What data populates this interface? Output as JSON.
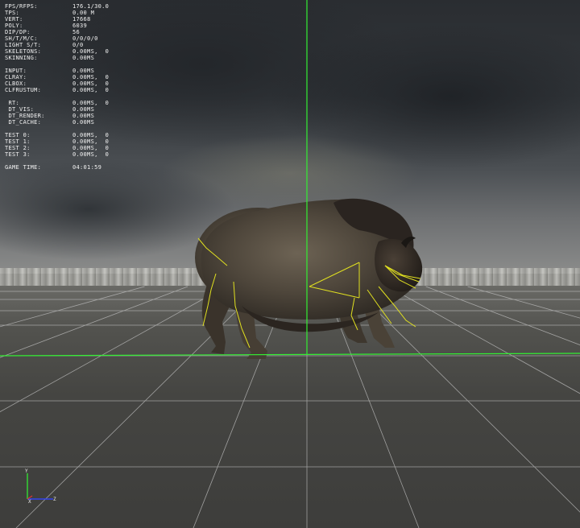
{
  "hud": {
    "stats": [
      {
        "label": "FPS/RFPS:",
        "value": "176.1/30.0"
      },
      {
        "label": "TPS:",
        "value": "0.00 M"
      },
      {
        "label": "VERT:",
        "value": "17668"
      },
      {
        "label": "POLY:",
        "value": "6039"
      },
      {
        "label": "DIP/DP:",
        "value": "56"
      },
      {
        "label": "SH/T/M/C:",
        "value": "0/0/0/0"
      },
      {
        "label": "LIGHT S/T:",
        "value": "0/0"
      },
      {
        "label": "SKELETONS:",
        "value": "0.00MS,  0"
      },
      {
        "label": "SKINNING:",
        "value": "0.00MS"
      }
    ],
    "cl": [
      {
        "label": "INPUT:",
        "value": "0.00MS"
      },
      {
        "label": "CLRAY:",
        "value": "0.00MS,  0"
      },
      {
        "label": "CLBOX:",
        "value": "0.00MS,  0"
      },
      {
        "label": "CLFRUSTUM:",
        "value": "0.00MS,  0"
      }
    ],
    "rt": [
      {
        "label": " RT:",
        "value": "0.00MS,  0"
      },
      {
        "label": " DT_VIS:",
        "value": "0.00MS"
      },
      {
        "label": " DT_RENDER:",
        "value": "0.00MS"
      },
      {
        "label": " DT_CACHE:",
        "value": "0.00MS"
      }
    ],
    "tests": [
      {
        "label": "TEST 0:",
        "value": "0.00MS,  0"
      },
      {
        "label": "TEST 1:",
        "value": "0.00MS,  0"
      },
      {
        "label": "TEST 2:",
        "value": "0.00MS,  0"
      },
      {
        "label": "TEST 3:",
        "value": "0.00MS,  0"
      }
    ],
    "game_time": {
      "label": "GAME TIME:",
      "value": "04:01:59"
    }
  },
  "axes": {
    "y": "Y",
    "x": "X",
    "z": "Z"
  },
  "colors": {
    "guide_line": "#33ee33",
    "bone_line": "#e0e020",
    "grid_line": "#bfbfbf",
    "axis_y": "#33dd33",
    "axis_z": "#3344ee"
  },
  "icons": {
    "model": "bison-model",
    "gizmo": "axis-gizmo-icon"
  }
}
